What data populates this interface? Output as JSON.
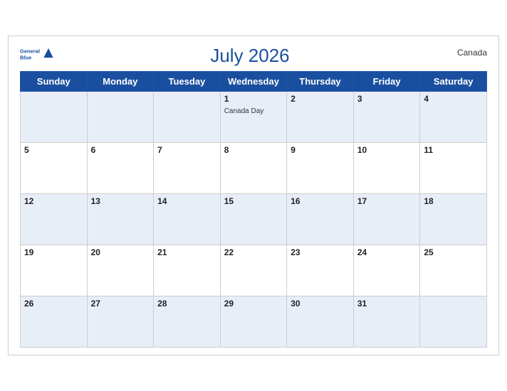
{
  "header": {
    "title": "July 2026",
    "country": "Canada",
    "logo_line1": "General",
    "logo_line2": "Blue"
  },
  "weekdays": [
    "Sunday",
    "Monday",
    "Tuesday",
    "Wednesday",
    "Thursday",
    "Friday",
    "Saturday"
  ],
  "weeks": [
    [
      {
        "day": "",
        "empty": true
      },
      {
        "day": "",
        "empty": true
      },
      {
        "day": "",
        "empty": true
      },
      {
        "day": "1",
        "event": "Canada Day"
      },
      {
        "day": "2"
      },
      {
        "day": "3"
      },
      {
        "day": "4"
      }
    ],
    [
      {
        "day": "5"
      },
      {
        "day": "6"
      },
      {
        "day": "7"
      },
      {
        "day": "8"
      },
      {
        "day": "9"
      },
      {
        "day": "10"
      },
      {
        "day": "11"
      }
    ],
    [
      {
        "day": "12"
      },
      {
        "day": "13"
      },
      {
        "day": "14"
      },
      {
        "day": "15"
      },
      {
        "day": "16"
      },
      {
        "day": "17"
      },
      {
        "day": "18"
      }
    ],
    [
      {
        "day": "19"
      },
      {
        "day": "20"
      },
      {
        "day": "21"
      },
      {
        "day": "22"
      },
      {
        "day": "23"
      },
      {
        "day": "24"
      },
      {
        "day": "25"
      }
    ],
    [
      {
        "day": "26"
      },
      {
        "day": "27"
      },
      {
        "day": "28"
      },
      {
        "day": "29"
      },
      {
        "day": "30"
      },
      {
        "day": "31"
      },
      {
        "day": "",
        "empty": true
      }
    ]
  ]
}
